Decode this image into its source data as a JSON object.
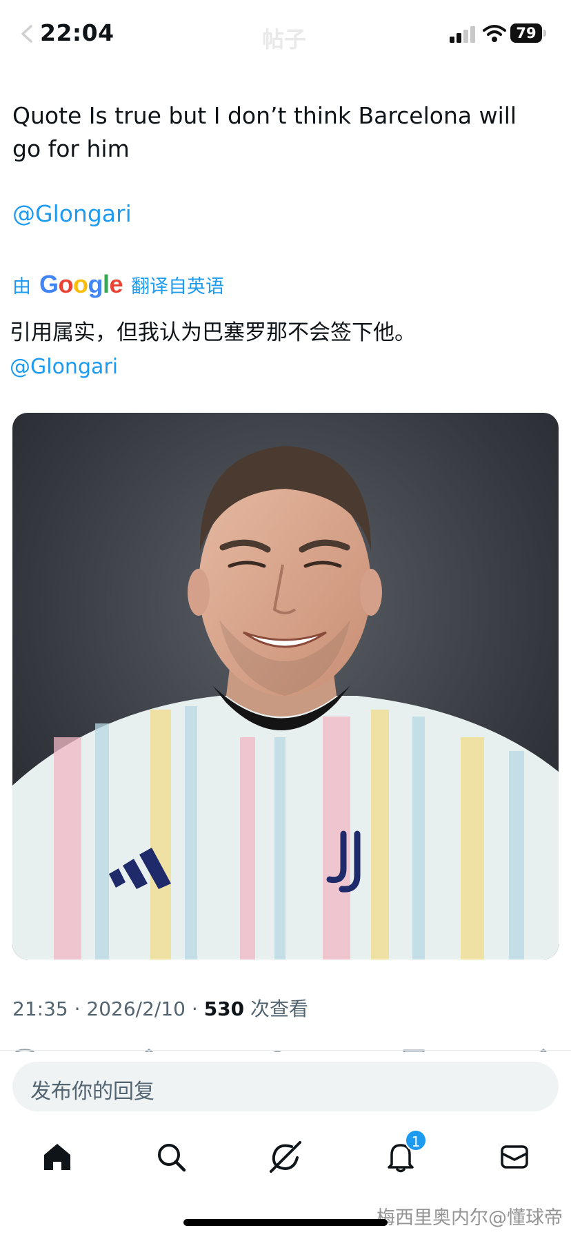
{
  "status_bar": {
    "time": "22:04",
    "faded_title": "帖子",
    "battery": "79",
    "icons": [
      "back-chevron-icon",
      "cellular-signal-icon",
      "wifi-icon",
      "battery-icon"
    ]
  },
  "tweet": {
    "text": "Quote Is true but I don’t think Barcelona will go for him",
    "mention": "@Glongari",
    "translation": {
      "by": "由",
      "provider": [
        "G",
        "o",
        "o",
        "g",
        "l",
        "e"
      ],
      "source_label": "翻译自英语",
      "text": "引用属实，但我认为巴塞罗那不会签下他。",
      "mention": "@Glongari"
    },
    "meta": {
      "time": "21:35",
      "sep1": " · ",
      "date": "2026/2/10",
      "sep2": " · ",
      "views_count": "530",
      "views_label": " 次查看"
    }
  },
  "reply": {
    "placeholder": "发布你的回复"
  },
  "bottom_nav": {
    "items": [
      {
        "name": "home",
        "icon": "home-icon",
        "active": true
      },
      {
        "name": "search",
        "icon": "search-icon"
      },
      {
        "name": "grok",
        "icon": "grok-icon"
      },
      {
        "name": "notifications",
        "icon": "bell-icon",
        "badge": "1"
      },
      {
        "name": "messages",
        "icon": "mail-icon"
      }
    ]
  },
  "watermark": "梅西里奥内尔@懂球帝",
  "colors": {
    "accent": "#1d9bf0",
    "text": "#0f1419",
    "secondary": "#536471",
    "reply_bg": "#eff3f4"
  }
}
